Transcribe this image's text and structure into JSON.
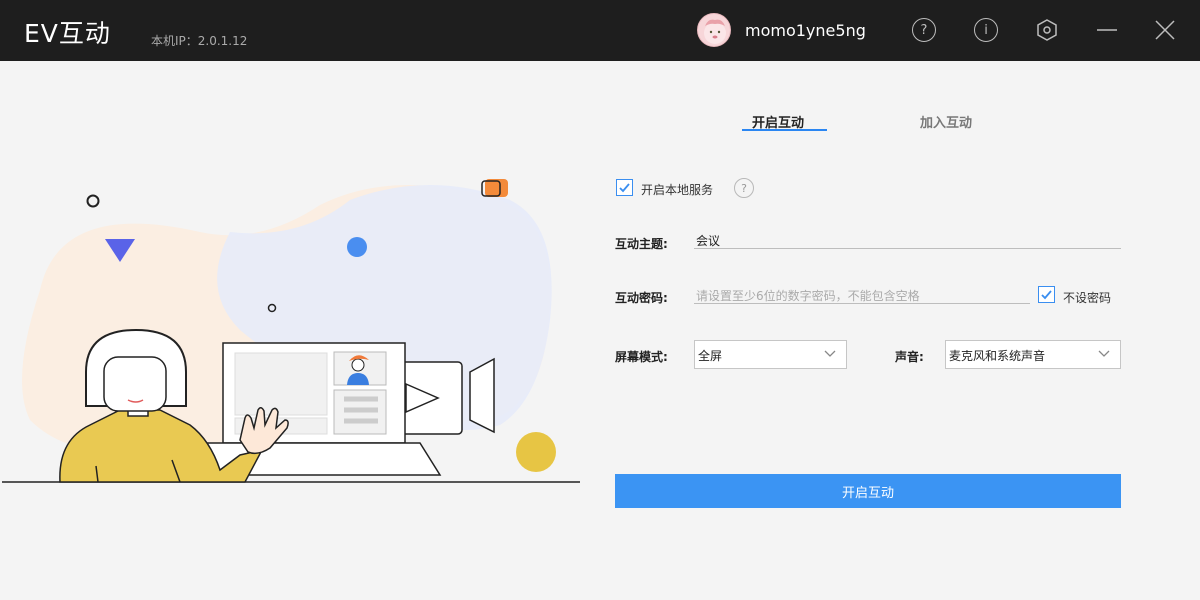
{
  "app": {
    "title": "EV互动",
    "local_ip": "本机IP：2.0.1.12"
  },
  "user": {
    "name": "momo1yne5ng"
  },
  "titlebar_icons": [
    "help-circle-icon",
    "info-icon",
    "settings-hexagon-icon",
    "minimize-icon",
    "close-icon"
  ],
  "titlebar_glyphs": {
    "help": "?",
    "info": "i"
  },
  "tabs": [
    {
      "label": "开启互动",
      "active": true
    },
    {
      "label": "加入互动",
      "active": false
    }
  ],
  "form": {
    "local_service": {
      "label": "开启本地服务",
      "checked": true,
      "help": "?"
    },
    "topic": {
      "label": "互动主题:",
      "value": "会议"
    },
    "password": {
      "label": "互动密码:",
      "placeholder": "请设置至少6位的数字密码，不能包含空格",
      "no_password_label": "不设密码",
      "no_password_checked": true
    },
    "screen_mode": {
      "label": "屏幕模式:",
      "value": "全屏"
    },
    "sound": {
      "label": "声音:",
      "value": "麦克风和系统声音"
    },
    "submit_label": "开启互动"
  },
  "colors": {
    "accent": "#3b94f3",
    "titlebar": "#1e1e1e",
    "background": "#f4f4f4"
  }
}
